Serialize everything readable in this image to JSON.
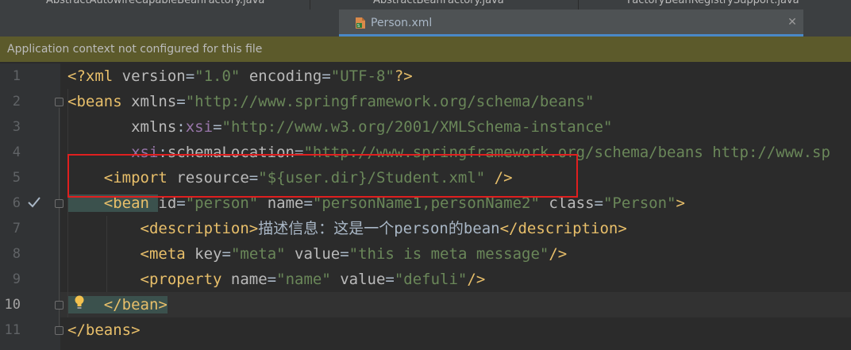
{
  "top_tabs": [
    {
      "label": "AbstractAutowireCapableBeanFactory.java"
    },
    {
      "label": "AbstractBeanFactory.java"
    },
    {
      "label": "FactoryBeanRegistrySupport.java"
    }
  ],
  "active_tab": {
    "label": "Person.xml",
    "icon": "xml-file-icon"
  },
  "notification": {
    "text": "Application context not configured for this file"
  },
  "colors": {
    "tag": "#e8bf6a",
    "attr": "#bababa",
    "value": "#6a8759",
    "namespace": "#9876aa",
    "text": "#a9b7c6",
    "highlight": "#e01f1f"
  },
  "lines": [
    {
      "no": "1",
      "tokens": [
        {
          "t": "<?xml ",
          "c": "decl"
        },
        {
          "t": "version",
          "c": "attr"
        },
        {
          "t": "=",
          "c": "plain"
        },
        {
          "t": "\"1.0\"",
          "c": "val"
        },
        {
          "t": " encoding",
          "c": "attr"
        },
        {
          "t": "=",
          "c": "plain"
        },
        {
          "t": "\"UTF-8\"",
          "c": "val"
        },
        {
          "t": "?>",
          "c": "decl"
        }
      ]
    },
    {
      "no": "2",
      "tokens": [
        {
          "t": "<beans ",
          "c": "tag"
        },
        {
          "t": "xmlns",
          "c": "attr"
        },
        {
          "t": "=",
          "c": "plain"
        },
        {
          "t": "\"http://www.springframework.org/schema/beans\"",
          "c": "val"
        }
      ]
    },
    {
      "no": "3",
      "tokens": [
        {
          "t": "       xmlns",
          "c": "attr"
        },
        {
          "t": ":",
          "c": "plain"
        },
        {
          "t": "xsi",
          "c": "ns"
        },
        {
          "t": "=",
          "c": "plain"
        },
        {
          "t": "\"http://www.w3.org/2001/XMLSchema-instance\"",
          "c": "val"
        }
      ]
    },
    {
      "no": "4",
      "tokens": [
        {
          "t": "       xsi",
          "c": "ns"
        },
        {
          "t": ":",
          "c": "plain"
        },
        {
          "t": "schemaLocation",
          "c": "attr"
        },
        {
          "t": "=",
          "c": "plain"
        },
        {
          "t": "\"http://www.springframework.org/schema/beans http://www.sp",
          "c": "val"
        }
      ]
    },
    {
      "no": "5",
      "tokens": [
        {
          "t": "    <import ",
          "c": "tag"
        },
        {
          "t": "resource",
          "c": "attr"
        },
        {
          "t": "=",
          "c": "plain"
        },
        {
          "t": "\"${user.dir}/Student.xml\"",
          "c": "val"
        },
        {
          "t": " />",
          "c": "tag"
        }
      ]
    },
    {
      "no": "6",
      "tokens": [
        {
          "t": "    <bean ",
          "c": "tag"
        },
        {
          "t": "id",
          "c": "attr"
        },
        {
          "t": "=",
          "c": "plain"
        },
        {
          "t": "\"person\"",
          "c": "val"
        },
        {
          "t": " name",
          "c": "attr"
        },
        {
          "t": "=",
          "c": "plain"
        },
        {
          "t": "\"personName1,personName2\"",
          "c": "val"
        },
        {
          "t": " class",
          "c": "attr"
        },
        {
          "t": "=",
          "c": "plain"
        },
        {
          "t": "\"Person\"",
          "c": "val"
        },
        {
          "t": ">",
          "c": "tag"
        }
      ]
    },
    {
      "no": "7",
      "tokens": [
        {
          "t": "        <description>",
          "c": "tag"
        },
        {
          "t": "描述信息：这是一个person的bean",
          "c": "plain"
        },
        {
          "t": "</description>",
          "c": "tag"
        }
      ]
    },
    {
      "no": "8",
      "tokens": [
        {
          "t": "        <meta ",
          "c": "tag"
        },
        {
          "t": "key",
          "c": "attr"
        },
        {
          "t": "=",
          "c": "plain"
        },
        {
          "t": "\"meta\"",
          "c": "val"
        },
        {
          "t": " value",
          "c": "attr"
        },
        {
          "t": "=",
          "c": "plain"
        },
        {
          "t": "\"this is meta message\"",
          "c": "val"
        },
        {
          "t": "/>",
          "c": "tag"
        }
      ]
    },
    {
      "no": "9",
      "tokens": [
        {
          "t": "        <property ",
          "c": "tag"
        },
        {
          "t": "name",
          "c": "attr"
        },
        {
          "t": "=",
          "c": "plain"
        },
        {
          "t": "\"name\"",
          "c": "val"
        },
        {
          "t": " value",
          "c": "attr"
        },
        {
          "t": "=",
          "c": "plain"
        },
        {
          "t": "\"defuli\"",
          "c": "val"
        },
        {
          "t": "/>",
          "c": "tag"
        }
      ]
    },
    {
      "no": "10",
      "tokens": [
        {
          "t": "    </bean>",
          "c": "tag"
        }
      ]
    },
    {
      "no": "11",
      "tokens": [
        {
          "t": "</beans>",
          "c": "tag"
        }
      ]
    }
  ]
}
